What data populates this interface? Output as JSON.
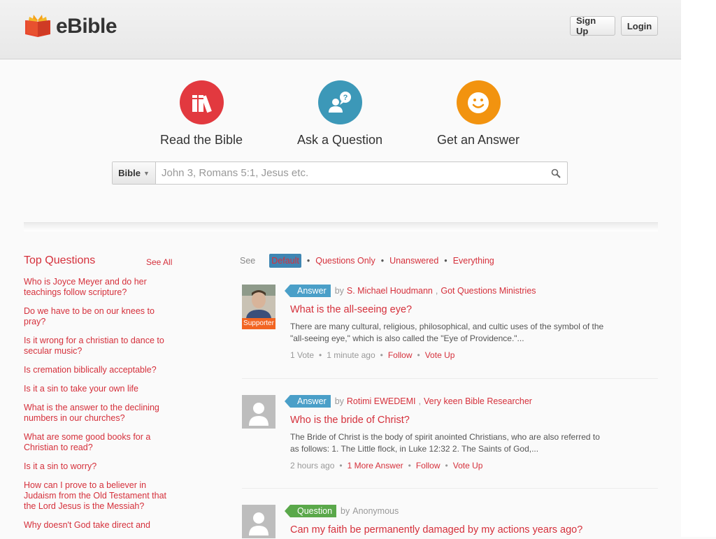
{
  "brand": {
    "name": "eBible"
  },
  "header": {
    "signup_label": "Sign Up",
    "login_label": "Login"
  },
  "features": [
    {
      "label": "Read the Bible",
      "color": "#e2393f",
      "icon": "books-icon"
    },
    {
      "label": "Ask a Question",
      "color": "#3c98b8",
      "icon": "user-question-icon"
    },
    {
      "label": "Get an Answer",
      "color": "#f2930f",
      "icon": "smiley-icon"
    }
  ],
  "search": {
    "scope_label": "Bible",
    "placeholder": "John 3, Romans 5:1, Jesus etc."
  },
  "sidebar": {
    "title": "Top Questions",
    "see_all": "See All",
    "questions": [
      "Who is Joyce Meyer and do her teachings follow scripture?",
      "Do we have to be on our knees to pray?",
      "Is it wrong for a christian to dance to secular music?",
      "Is cremation biblically acceptable?",
      "Is it a sin to take your own life",
      "What is the answer to the declining numbers in our churches?",
      "What are some good books for a Christian to read?",
      "Is it a sin to worry?",
      "How can I prove to a believer in Judaism from the Old Testament that the Lord Jesus is the Messiah?",
      "Why doesn't God take direct and"
    ]
  },
  "filters": {
    "see_label": "See",
    "items": [
      "Default",
      "Questions Only",
      "Unanswered",
      "Everything"
    ]
  },
  "feed": [
    {
      "type": "Answer",
      "by": "by",
      "author": "S. Michael Houdmann",
      "affiliation": "Got Questions Ministries",
      "badge": "Supporter",
      "title": "What is the all-seeing eye?",
      "excerpt": "There are many cultural, religious, philosophical, and cultic uses of the symbol of the \"all-seeing eye,\" which is also called the \"Eye of Providence.\"...",
      "votes": "1 Vote",
      "time": "1 minute ago",
      "follow": "Follow",
      "vote_up": "Vote Up"
    },
    {
      "type": "Answer",
      "by": "by",
      "author": "Rotimi EWEDEMI",
      "affiliation": "Very keen Bible Researcher",
      "title": "Who is the bride of Christ?",
      "excerpt": "The Bride of Christ is the body of spirit anointed Christians, who are also referred to as follows: 1. The Little flock, in Luke 12:32 2. The Saints of God,...",
      "time": "2 hours ago",
      "more": "1 More Answer",
      "follow": "Follow",
      "vote_up": "Vote Up"
    },
    {
      "type": "Question",
      "by": "by",
      "author": "Anonymous",
      "title": "Can my faith be permanently damaged by my actions years ago?"
    }
  ]
}
